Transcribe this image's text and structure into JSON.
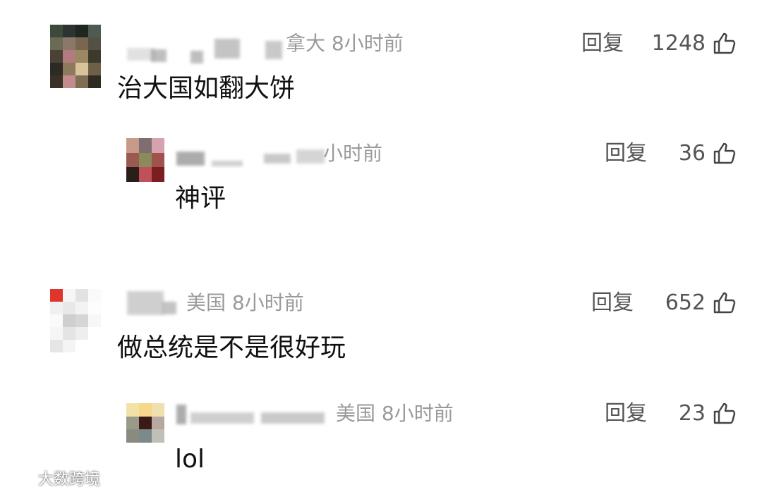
{
  "comments": [
    {
      "location_time": "拿大 8小时前",
      "reply_label": "回复",
      "likes": "1248",
      "text": "治大国如翻大饼",
      "reply": {
        "location_time": "小时前",
        "reply_label": "回复",
        "likes": "36",
        "text": "神评"
      }
    },
    {
      "location_time": "美国 8小时前",
      "reply_label": "回复",
      "likes": "652",
      "text": "做总统是不是很好玩",
      "reply": {
        "location_time": "美国 8小时前",
        "reply_label": "回复",
        "likes": "23",
        "text": "lol"
      }
    }
  ],
  "watermark": {
    "text": "大数跨境",
    "icon": "brand-logo"
  },
  "icons": {
    "like": "thumbs-up-icon"
  },
  "colors": {
    "meta": "#9a9a9a",
    "text": "#111111",
    "background": "#ffffff"
  }
}
